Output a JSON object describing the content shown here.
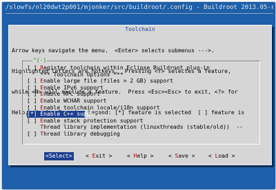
{
  "window": {
    "title": "/slowfs/nl20dwt2p001/mjonker/src/buildroot/.config - Buildroot 2013.05-rc1-0007"
  },
  "dialog": {
    "title": "Toolchain",
    "help_lines": [
      "Arrow keys navigate the menu.  <Enter> selects submenus --->.",
      "Highlighted letters are hotkeys.  Pressing <Y> selectes a feature,",
      "while <N> will exclude a feature.  Press <Esc><Esc> to exit, <?> for",
      "Help, </> for Search.  Legend: [*] feature is selected  [ ] feature is"
    ],
    "scroll_indicator": "^(-)",
    "menu": [
      {
        "pre": "[ ] ",
        "hot": "R",
        "rest": "egister toolchain within Eclipse Buildroot plug-in"
      },
      {
        "pre": "    ",
        "hot": "",
        "rest": "*** Toolchain Options ***"
      },
      {
        "pre": "[ ] ",
        "hot": "E",
        "rest": "nable large file (files > 2 GB) support"
      },
      {
        "pre": "[ ] ",
        "hot": "E",
        "rest": "nable IPv6 support"
      },
      {
        "pre": "[ ] ",
        "hot": "E",
        "rest": "nable RPC support"
      },
      {
        "pre": "[ ] ",
        "hot": "E",
        "rest": "nable WCHAR support"
      },
      {
        "pre": "[ ] ",
        "hot": "E",
        "rest": "nable toolchain locale/i18n support"
      },
      {
        "pre": "[*] ",
        "hot": "E",
        "rest": "nable C++ support"
      },
      {
        "pre": "[ ] ",
        "hot": "E",
        "rest": "nable stack protection support"
      },
      {
        "pre": "    ",
        "hot": "T",
        "rest": "hread library implementation (linuxthreads (stable/old))  --"
      },
      {
        "pre": "[ ] ",
        "hot": "T",
        "rest": "hread library debugging"
      }
    ],
    "selected_index": 7,
    "buttons": {
      "select": {
        "open": "<",
        "hot": "S",
        "rest": "elect>"
      },
      "exit": {
        "open": "< ",
        "hot": "E",
        "rest": "xit >"
      },
      "help": {
        "open": "< ",
        "hot": "H",
        "rest": "elp >"
      },
      "save": {
        "open": "< ",
        "hot": "S",
        "rest": "ave >"
      },
      "load": {
        "open": "< ",
        "hot": "L",
        "rest": "oad >"
      }
    }
  },
  "colors": {
    "background": "#1d5fa8",
    "dialog": "#d6d6d6",
    "highlight": "#1f3f8f",
    "hotkey": "#b30000",
    "scroll_indicator": "#1a8a1a"
  }
}
